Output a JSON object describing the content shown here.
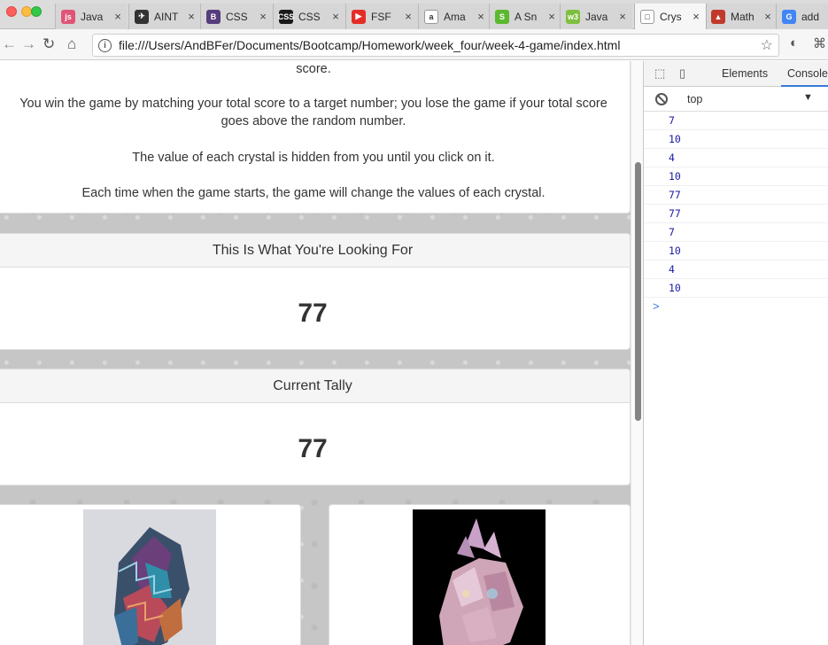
{
  "browser": {
    "tabs": [
      {
        "title": "Java",
        "favicon_color": "#e05577",
        "favicon_label": "js"
      },
      {
        "title": "AINT",
        "favicon_color": "#333333",
        "favicon_label": "✈"
      },
      {
        "title": "CSS",
        "favicon_color": "#563d7c",
        "favicon_label": "B"
      },
      {
        "title": "CSS",
        "favicon_color": "#1a1a1a",
        "favicon_label": "CSS"
      },
      {
        "title": "FSF",
        "favicon_color": "#e52d27",
        "favicon_label": "▶"
      },
      {
        "title": "Ama",
        "favicon_color": "#ffffff",
        "favicon_label": "a"
      },
      {
        "title": "A Sn",
        "favicon_color": "#5cb82e",
        "favicon_label": "S"
      },
      {
        "title": "Java",
        "favicon_color": "#7fbf3f",
        "favicon_label": "w3"
      },
      {
        "title": "Crys",
        "favicon_color": "#ffffff",
        "favicon_label": "□"
      },
      {
        "title": "Math",
        "favicon_color": "#c0392b",
        "favicon_label": "▲"
      },
      {
        "title": "add",
        "favicon_color": "#4285f4",
        "favicon_label": "G"
      }
    ],
    "active_tab_index": 8,
    "url": "file:///Users/AndBFer/Documents/Bootcamp/Homework/week_four/week-4-game/index.html"
  },
  "page": {
    "instructions": [
      "score.",
      "You win the game by matching your total score to a target number; you lose the game if your total score goes above the random number.",
      "The value of each crystal is hidden from you until you click on it.",
      "Each time when the game starts, the game will change the values of each crystal."
    ],
    "target": {
      "heading": "This Is What You're Looking For",
      "value": "77"
    },
    "tally": {
      "heading": "Current Tally",
      "value": "77"
    }
  },
  "devtools": {
    "tabs": [
      "Elements",
      "Console"
    ],
    "active_tab": "Console",
    "context": "top",
    "console_logs": [
      "7",
      "10",
      "4",
      "10",
      "77",
      "77",
      "7",
      "10",
      "4",
      "10"
    ],
    "prompt": ">"
  },
  "colors": {
    "accent": "#3879d9",
    "log_text": "#1a1aa6"
  }
}
